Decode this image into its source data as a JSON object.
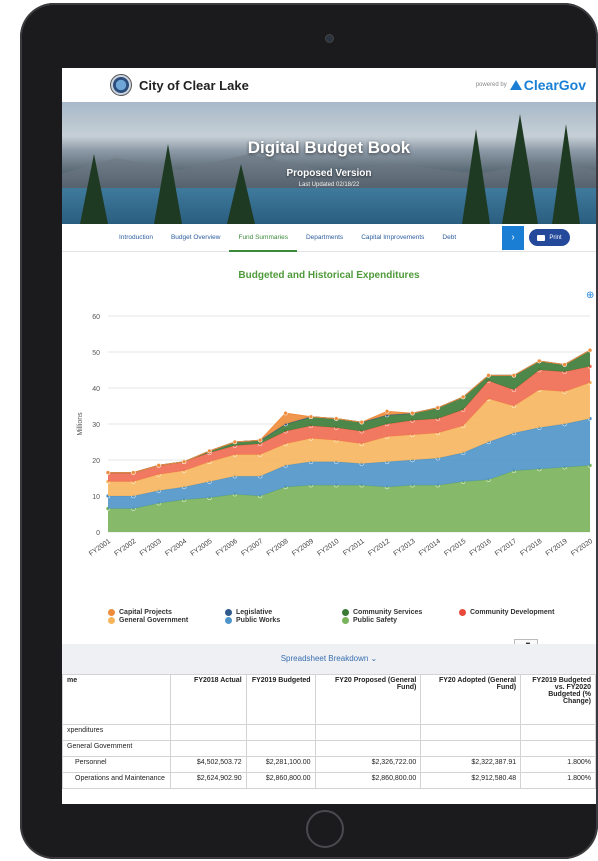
{
  "header": {
    "city": "City of Clear Lake",
    "powered": "powered by",
    "brand": "ClearGov"
  },
  "hero": {
    "title": "Digital Budget Book",
    "subtitle": "Proposed Version",
    "updated": "Last Updated 02/18/22"
  },
  "nav": {
    "tabs": [
      "Introduction",
      "Budget Overview",
      "Fund Summaries",
      "Departments",
      "Capital Improvements",
      "Debt"
    ],
    "active": "Fund Summaries",
    "next": "›",
    "print": "Print"
  },
  "chart_data": {
    "type": "area",
    "title": "Budgeted and Historical Expenditures",
    "ylabel": "Millions",
    "ylim": [
      0,
      60
    ],
    "yticks": [
      0,
      10,
      20,
      30,
      40,
      50,
      60
    ],
    "categories": [
      "FY2001",
      "FY2002",
      "FY2003",
      "FY2004",
      "FY2005",
      "FY2006",
      "FY2007",
      "FY2008",
      "FY2009",
      "FY2010",
      "FY2011",
      "FY2012",
      "FY2013",
      "FY2014",
      "FY2015",
      "FY2016",
      "FY2017",
      "FY2018",
      "FY2019",
      "FY2020"
    ],
    "stacked": true,
    "series": [
      {
        "name": "Public Safety",
        "color": "#79b35a",
        "values": [
          6.5,
          6.5,
          8,
          9,
          9.5,
          10.5,
          10,
          12.5,
          13,
          13,
          13,
          12.5,
          13,
          13,
          14,
          14.5,
          17,
          17.5,
          18,
          18.5
        ]
      },
      {
        "name": "Public Works",
        "color": "#4e94c8",
        "values": [
          3.5,
          3.5,
          3.5,
          3.5,
          4.5,
          5,
          5.5,
          6,
          6.5,
          6.5,
          6,
          7,
          7,
          7.5,
          8,
          10.5,
          10.5,
          11.5,
          12,
          13
        ]
      },
      {
        "name": "General Government",
        "color": "#f6b55d",
        "values": [
          4,
          4,
          4.5,
          4.5,
          5.5,
          6,
          6,
          6,
          6.5,
          6,
          5.5,
          7,
          7,
          7,
          7.5,
          12,
          7.5,
          10.5,
          9,
          10
        ]
      },
      {
        "name": "Community Development",
        "color": "#ef6a50",
        "values": [
          2.5,
          2.5,
          2.5,
          2.5,
          2.5,
          2.5,
          3,
          3.5,
          3.5,
          3.5,
          3.5,
          3.5,
          4,
          4,
          4.5,
          5,
          4.5,
          5.5,
          5.5,
          4.5
        ]
      },
      {
        "name": "Community Services",
        "color": "#3a7a35",
        "values": [
          0,
          0,
          0,
          0,
          0.5,
          1,
          1,
          2,
          2.5,
          2.5,
          2.5,
          2.5,
          2,
          3,
          3.5,
          1.5,
          4,
          2.5,
          2,
          4.5
        ]
      },
      {
        "name": "Legislative",
        "color": "#2f5b8c",
        "values": [
          0,
          0,
          0,
          0,
          0,
          0,
          0,
          0,
          0,
          0,
          0,
          0,
          0,
          0,
          0,
          0,
          0,
          0,
          0,
          0
        ]
      },
      {
        "name": "Capital Projects",
        "color": "#ee8c3b",
        "values": [
          0,
          0,
          0,
          0,
          0,
          0,
          0,
          3,
          0,
          0,
          0,
          1,
          0,
          0,
          0,
          0,
          0,
          0,
          0,
          0
        ]
      }
    ],
    "legend_position": "bottom",
    "grid": true
  },
  "legend": [
    {
      "name": "Capital Projects",
      "color": "#ee8c3b"
    },
    {
      "name": "Legislative",
      "color": "#2f5b8c"
    },
    {
      "name": "Community Services",
      "color": "#3a7a35"
    },
    {
      "name": "Community Development",
      "color": "#e8493a"
    },
    {
      "name": "General Government",
      "color": "#f6b55d"
    },
    {
      "name": "Public Works",
      "color": "#4e94c8"
    },
    {
      "name": "Public Safety",
      "color": "#79b35a"
    }
  ],
  "breakdown": {
    "label": "Spreadsheet Breakdown ⌄"
  },
  "table": {
    "headers": [
      "me",
      "FY2018 Actual",
      "FY2019 Budgeted",
      "FY20 Proposed (General Fund)",
      "FY20 Adopted (General Fund)",
      "FY2019 Budgeted vs. FY2020 Budgeted (% Change)"
    ],
    "rows": [
      [
        "xpenditures",
        "",
        "",
        "",
        "",
        ""
      ],
      [
        "General Government",
        "",
        "",
        "",
        "",
        ""
      ],
      [
        "Personnel",
        "$4,502,503.72",
        "$2,281,100.00",
        "$2,326,722.00",
        "$2,322,387.91",
        "1.800%"
      ],
      [
        "Operations and Maintenance",
        "$2,624,902.90",
        "$2,860,800.00",
        "$2,860,800.00",
        "$2,912,580.48",
        "1.800%"
      ]
    ]
  }
}
